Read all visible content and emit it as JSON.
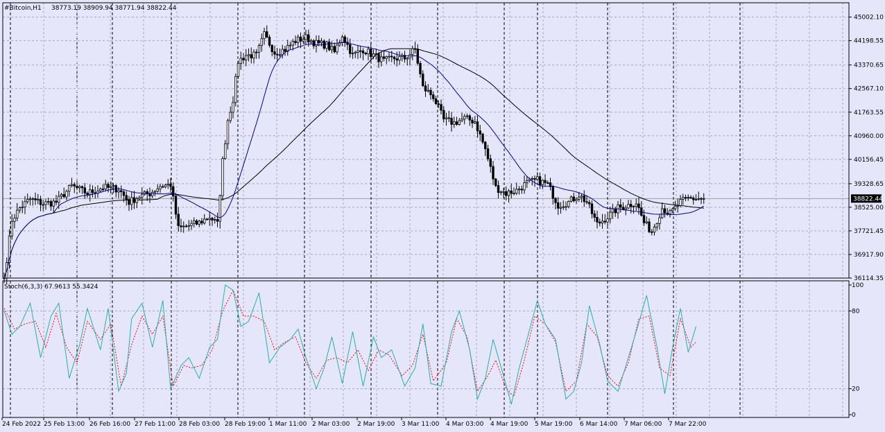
{
  "header": {
    "symbol": "#Bitcoin,H1",
    "ohlc": "38773.19 38909.94 38771.94 38822.44"
  },
  "stoch_header": "Stoch(6,3,3) 67.9613 55.3424",
  "current_price_label": "38822.44",
  "colors": {
    "background": "#E6E6FA",
    "bull": "#FFFFFF",
    "bear": "#000000",
    "fast_ma": "#0000A0",
    "slow_ma": "#000000",
    "stoch_main": "#20B2AA",
    "stoch_signal": "#FF0000",
    "grid": "#A8A8B8"
  },
  "chart_data": [
    {
      "type": "candlestick",
      "timeframe": "H1",
      "ylim": [
        36114.35,
        45300
      ],
      "price_ticks": [
        "45002.10",
        "44198.55",
        "43370.65",
        "42567.10",
        "41763.55",
        "40960.00",
        "40156.45",
        "39328.65",
        "38525.00",
        "37721.45",
        "36917.90",
        "36114.35"
      ],
      "current_price": 38822.44,
      "x_tick_labels": [
        "24 Feb 2022",
        "25 Feb 13:00",
        "26 Feb 16:00",
        "27 Feb 11:00",
        "28 Feb 03:00",
        "28 Feb 19:00",
        "1 Mar 11:00",
        "2 Mar 03:00",
        "2 Mar 19:00",
        "3 Mar 11:00",
        "4 Mar 03:00",
        "4 Mar 19:00",
        "5 Mar 19:00",
        "6 Mar 14:00",
        "7 Mar 06:00",
        "7 Mar 22:00"
      ],
      "close_anchors": [
        [
          0,
          36114
        ],
        [
          3,
          38100
        ],
        [
          6,
          38500
        ],
        [
          10,
          38800
        ],
        [
          15,
          38650
        ],
        [
          20,
          38700
        ],
        [
          26,
          39250
        ],
        [
          32,
          39000
        ],
        [
          38,
          39200
        ],
        [
          44,
          39150
        ],
        [
          48,
          38700
        ],
        [
          52,
          38900
        ],
        [
          56,
          39000
        ],
        [
          60,
          39250
        ],
        [
          64,
          39300
        ],
        [
          67,
          37800
        ],
        [
          71,
          37900
        ],
        [
          75,
          38000
        ],
        [
          79,
          38200
        ],
        [
          82,
          37950
        ],
        [
          84,
          40100
        ],
        [
          86,
          41500
        ],
        [
          88,
          42200
        ],
        [
          90,
          43500
        ],
        [
          93,
          43700
        ],
        [
          97,
          43700
        ],
        [
          100,
          44400
        ],
        [
          104,
          43800
        ],
        [
          108,
          43900
        ],
        [
          112,
          44200
        ],
        [
          116,
          44300
        ],
        [
          120,
          44100
        ],
        [
          124,
          44050
        ],
        [
          127,
          43800
        ],
        [
          130,
          44400
        ],
        [
          134,
          43700
        ],
        [
          138,
          43900
        ],
        [
          142,
          43700
        ],
        [
          146,
          43500
        ],
        [
          150,
          43600
        ],
        [
          154,
          43600
        ],
        [
          158,
          43900
        ],
        [
          161,
          42600
        ],
        [
          165,
          42300
        ],
        [
          169,
          41500
        ],
        [
          173,
          41400
        ],
        [
          177,
          41550
        ],
        [
          181,
          41450
        ],
        [
          185,
          40500
        ],
        [
          189,
          39200
        ],
        [
          193,
          39000
        ],
        [
          197,
          39100
        ],
        [
          201,
          39350
        ],
        [
          205,
          39450
        ],
        [
          209,
          39300
        ],
        [
          213,
          38600
        ],
        [
          217,
          38700
        ],
        [
          221,
          38950
        ],
        [
          224,
          38700
        ],
        [
          228,
          37950
        ],
        [
          232,
          38200
        ],
        [
          236,
          38500
        ],
        [
          240,
          38600
        ],
        [
          243,
          38700
        ],
        [
          246,
          38000
        ],
        [
          249,
          37700
        ],
        [
          253,
          38500
        ],
        [
          256,
          38300
        ],
        [
          260,
          38700
        ],
        [
          263,
          38822
        ]
      ],
      "fast_ma": {
        "period": 20
      },
      "slow_ma": {
        "period": 60
      }
    },
    {
      "type": "line",
      "name": "Stoch(6,3,3)",
      "ylim": [
        0,
        100
      ],
      "levels": [
        20,
        80
      ],
      "y_tick_labels": [
        "100",
        "80",
        "20",
        "0"
      ],
      "last_main": 67.9613,
      "last_signal": 55.3424,
      "main_anchors": [
        [
          0,
          80
        ],
        [
          3,
          62
        ],
        [
          6,
          68
        ],
        [
          10,
          86
        ],
        [
          14,
          44
        ],
        [
          18,
          76
        ],
        [
          21,
          86
        ],
        [
          25,
          28
        ],
        [
          29,
          54
        ],
        [
          32,
          82
        ],
        [
          37,
          50
        ],
        [
          40,
          82
        ],
        [
          44,
          18
        ],
        [
          47,
          32
        ],
        [
          49,
          74
        ],
        [
          53,
          86
        ],
        [
          57,
          52
        ],
        [
          61,
          88
        ],
        [
          64,
          20
        ],
        [
          68,
          38
        ],
        [
          71,
          44
        ],
        [
          75,
          28
        ],
        [
          79,
          52
        ],
        [
          82,
          58
        ],
        [
          85,
          100
        ],
        [
          88,
          96
        ],
        [
          91,
          68
        ],
        [
          94,
          72
        ],
        [
          98,
          94
        ],
        [
          102,
          40
        ],
        [
          106,
          52
        ],
        [
          110,
          58
        ],
        [
          113,
          66
        ],
        [
          116,
          44
        ],
        [
          120,
          20
        ],
        [
          123,
          36
        ],
        [
          126,
          60
        ],
        [
          130,
          24
        ],
        [
          134,
          64
        ],
        [
          138,
          22
        ],
        [
          142,
          60
        ],
        [
          145,
          44
        ],
        [
          149,
          50
        ],
        [
          154,
          22
        ],
        [
          158,
          36
        ],
        [
          161,
          70
        ],
        [
          164,
          24
        ],
        [
          168,
          22
        ],
        [
          172,
          64
        ],
        [
          175,
          80
        ],
        [
          179,
          50
        ],
        [
          182,
          12
        ],
        [
          185,
          28
        ],
        [
          188,
          58
        ],
        [
          192,
          30
        ],
        [
          195,
          8
        ],
        [
          198,
          36
        ],
        [
          201,
          58
        ],
        [
          205,
          88
        ],
        [
          208,
          70
        ],
        [
          212,
          58
        ],
        [
          216,
          12
        ],
        [
          219,
          18
        ],
        [
          222,
          40
        ],
        [
          225,
          84
        ],
        [
          229,
          54
        ],
        [
          232,
          26
        ],
        [
          236,
          18
        ],
        [
          240,
          44
        ],
        [
          243,
          64
        ],
        [
          247,
          92
        ],
        [
          251,
          52
        ],
        [
          254,
          16
        ],
        [
          257,
          52
        ],
        [
          260,
          82
        ],
        [
          263,
          48
        ],
        [
          266,
          68
        ]
      ],
      "signal_anchors": [
        [
          0,
          82
        ],
        [
          4,
          66
        ],
        [
          8,
          70
        ],
        [
          12,
          72
        ],
        [
          16,
          52
        ],
        [
          20,
          78
        ],
        [
          24,
          52
        ],
        [
          28,
          40
        ],
        [
          32,
          72
        ],
        [
          37,
          58
        ],
        [
          41,
          70
        ],
        [
          45,
          22
        ],
        [
          49,
          54
        ],
        [
          53,
          76
        ],
        [
          57,
          62
        ],
        [
          61,
          76
        ],
        [
          65,
          22
        ],
        [
          69,
          38
        ],
        [
          72,
          36
        ],
        [
          76,
          38
        ],
        [
          80,
          50
        ],
        [
          84,
          80
        ],
        [
          88,
          96
        ],
        [
          92,
          76
        ],
        [
          96,
          76
        ],
        [
          100,
          72
        ],
        [
          104,
          50
        ],
        [
          108,
          56
        ],
        [
          112,
          60
        ],
        [
          116,
          40
        ],
        [
          120,
          28
        ],
        [
          124,
          42
        ],
        [
          128,
          44
        ],
        [
          132,
          40
        ],
        [
          136,
          50
        ],
        [
          140,
          34
        ],
        [
          144,
          50
        ],
        [
          148,
          46
        ],
        [
          153,
          30
        ],
        [
          157,
          38
        ],
        [
          161,
          62
        ],
        [
          165,
          26
        ],
        [
          170,
          40
        ],
        [
          174,
          74
        ],
        [
          178,
          60
        ],
        [
          182,
          18
        ],
        [
          186,
          30
        ],
        [
          189,
          42
        ],
        [
          193,
          20
        ],
        [
          196,
          14
        ],
        [
          200,
          42
        ],
        [
          204,
          76
        ],
        [
          208,
          70
        ],
        [
          212,
          56
        ],
        [
          216,
          18
        ],
        [
          220,
          26
        ],
        [
          224,
          70
        ],
        [
          228,
          60
        ],
        [
          232,
          30
        ],
        [
          236,
          22
        ],
        [
          240,
          40
        ],
        [
          244,
          74
        ],
        [
          248,
          76
        ],
        [
          252,
          36
        ],
        [
          256,
          30
        ],
        [
          260,
          74
        ],
        [
          264,
          52
        ],
        [
          266,
          56
        ]
      ]
    }
  ]
}
